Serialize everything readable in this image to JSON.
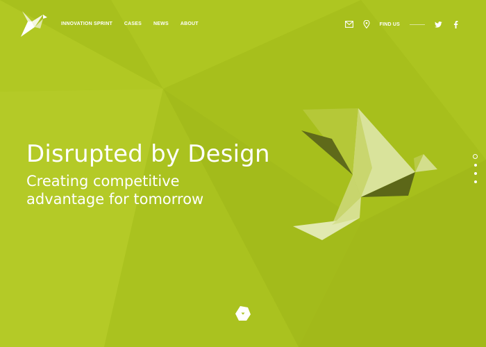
{
  "header": {
    "logo_icon": "origami-bird-logo",
    "nav": [
      {
        "label": "INNOVATION SPRINT"
      },
      {
        "label": "CASES"
      },
      {
        "label": "NEWS"
      },
      {
        "label": "ABOUT"
      }
    ],
    "icons": [
      "mail-icon",
      "location-pin-icon"
    ],
    "find_us_label": "FIND US",
    "social": [
      "twitter-icon",
      "facebook-icon"
    ]
  },
  "hero": {
    "title": "Disrupted by Design",
    "subtitle": "Creating competitive advantage for tomorrow"
  },
  "slides": {
    "count": 4,
    "active_index": 0
  },
  "scroll_icon": "chevron-down-icon",
  "colors": {
    "background": "#a9c11f",
    "text": "#ffffff",
    "bird_light": "#d8e39a",
    "bird_dark": "#5f6a1a"
  }
}
